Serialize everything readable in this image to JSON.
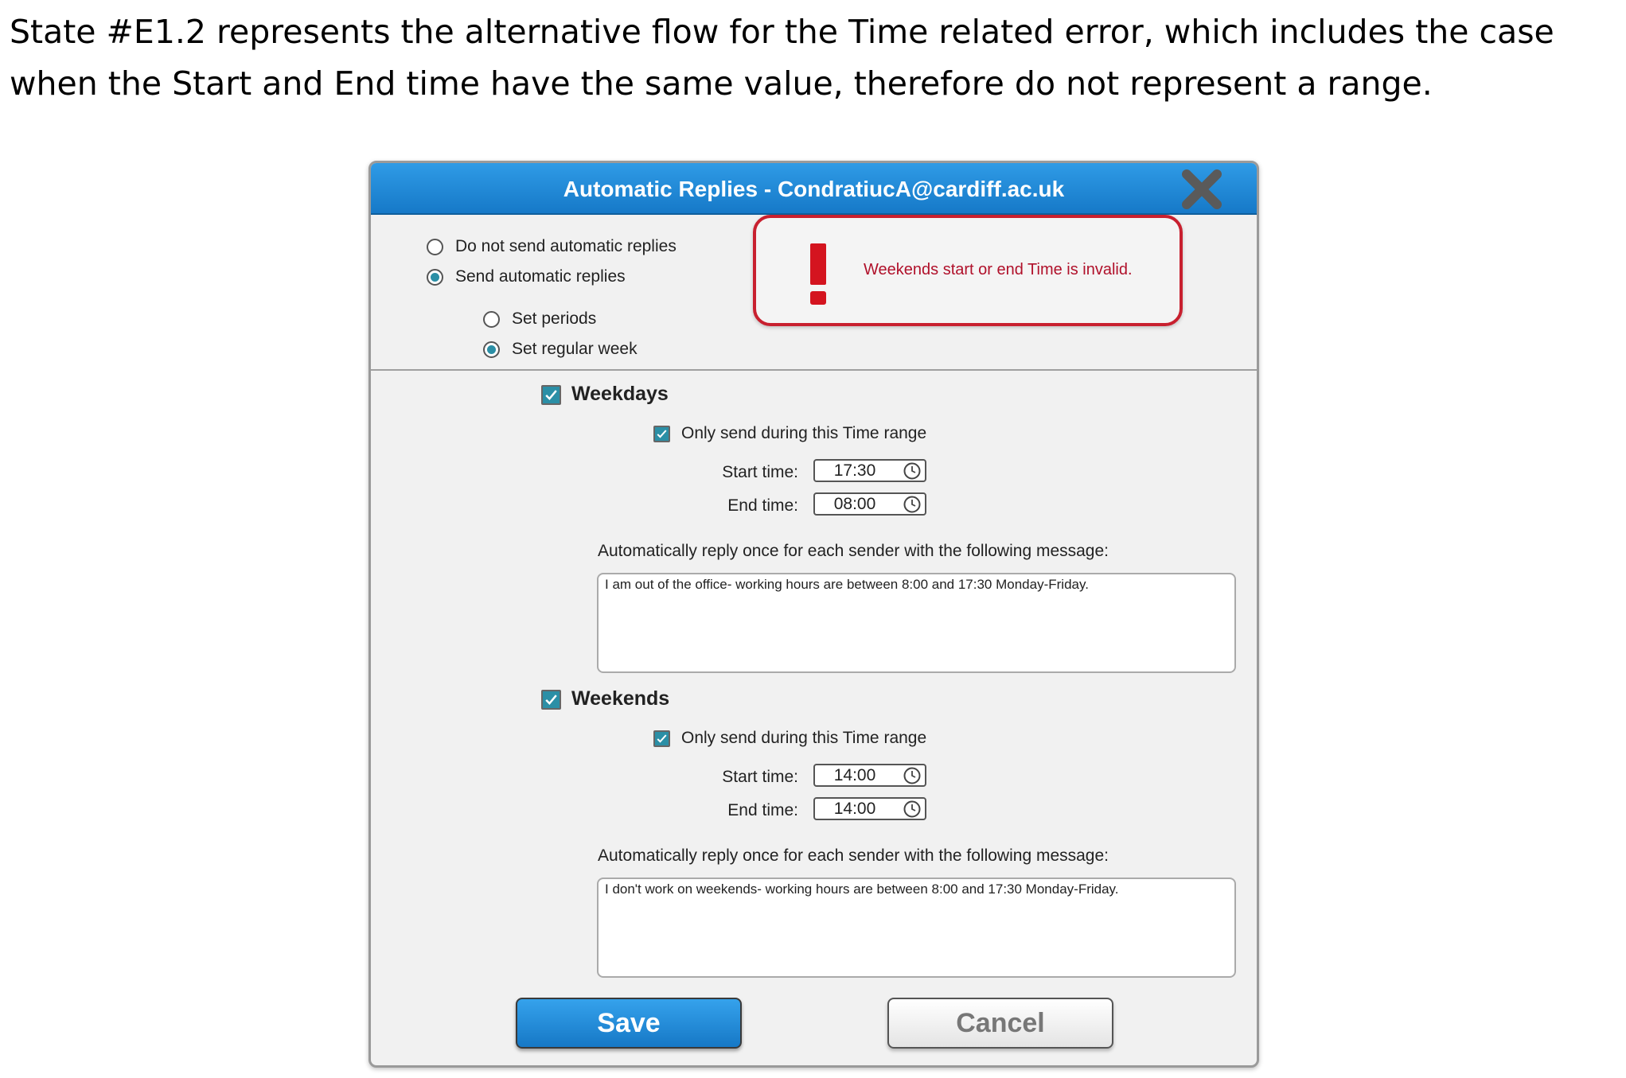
{
  "caption": {
    "line1": "State #E1.2 represents the alternative flow for the Time related error, which includes the case",
    "line2": "when the Start and End time have the same value, therefore do not represent a range."
  },
  "dialog": {
    "title": "Automatic Replies - CondratiucA@cardiff.ac.uk",
    "close_icon": "close-x-icon"
  },
  "reply_mode": {
    "options": [
      {
        "label": "Do not send automatic replies",
        "selected": false
      },
      {
        "label": "Send automatic replies",
        "selected": true
      }
    ],
    "sub_options": [
      {
        "label": "Set periods",
        "selected": false
      },
      {
        "label": "Set regular week",
        "selected": true
      }
    ]
  },
  "error": {
    "icon": "exclamation-icon",
    "message": "Weekends start or end Time is invalid.",
    "color": "#c8202f"
  },
  "weekdays": {
    "label": "Weekdays",
    "checked": true,
    "time_range_label": "Only send during this Time range",
    "time_range_checked": true,
    "start_label": "Start time:",
    "start_value": "17:30",
    "end_label": "End time:",
    "end_value": "08:00",
    "message_label": "Automatically reply once for each sender with the following message:",
    "message": "I am out of the office- working hours are between 8:00 and 17:30 Monday-Friday."
  },
  "weekends": {
    "label": "Weekends",
    "checked": true,
    "time_range_label": "Only send during this Time range",
    "time_range_checked": true,
    "start_label": "Start time:",
    "start_value": "14:00",
    "end_label": "End time:",
    "end_value": "14:00",
    "message_label": "Automatically reply once for each sender with the following message:",
    "message": "I don't work on weekends- working hours are between 8:00 and 17:30 Monday-Friday."
  },
  "buttons": {
    "save": "Save",
    "cancel": "Cancel"
  },
  "colors": {
    "title_bar": "#1b85d4",
    "accent": "#2b8fa6"
  }
}
